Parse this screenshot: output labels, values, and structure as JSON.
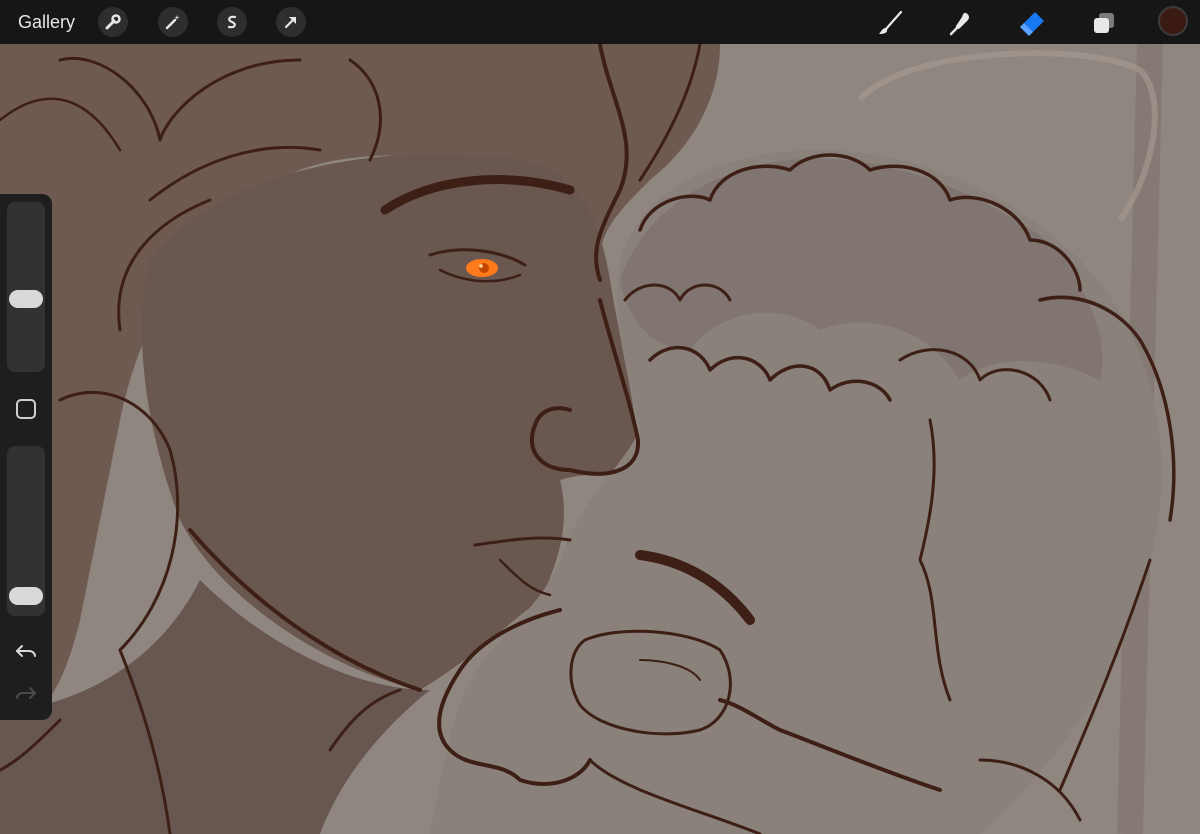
{
  "toolbar": {
    "gallery_label": "Gallery",
    "left_tools": [
      "wrench-icon",
      "magic-wand-icon",
      "selection-icon",
      "transform-arrow-icon"
    ],
    "right_tools": [
      "brush-icon",
      "smudge-icon",
      "eraser-icon",
      "layers-icon"
    ],
    "active_tool": "eraser",
    "active_color": "#3a1a12",
    "eraser_color": "#1877f2"
  },
  "sidebar": {
    "brush_size": 0.42,
    "opacity": 0.05
  },
  "canvas": {
    "background": "#8f867f",
    "line_color": "#3d1f15",
    "eye_color": "#ff7a1a"
  }
}
